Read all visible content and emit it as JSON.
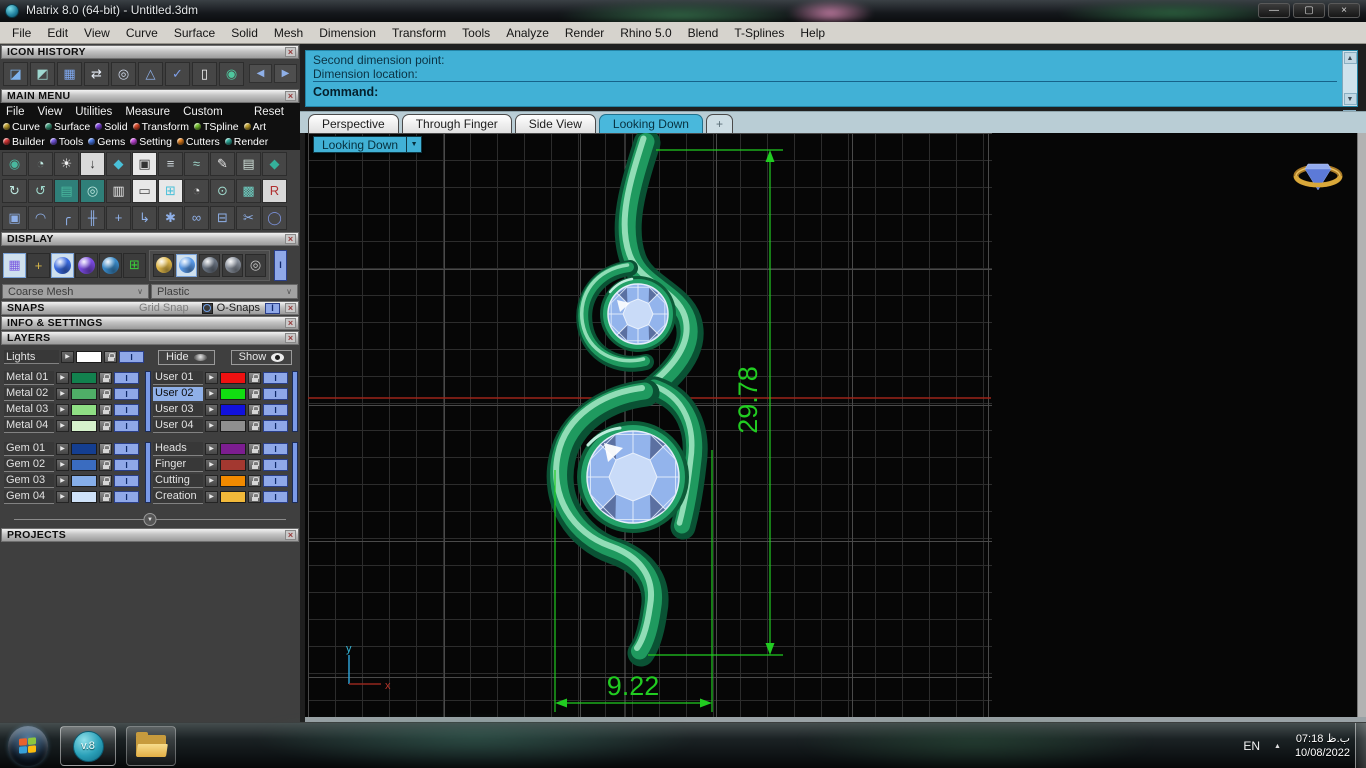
{
  "window": {
    "title": "Matrix 8.0 (64-bit) - Untitled.3dm",
    "minimize": "—",
    "restore": "▢",
    "close": "×"
  },
  "ui": {
    "x": "×",
    "back": "◀",
    "fwd": "▶",
    "up": "▲",
    "down": "▼",
    "caret": "∨"
  },
  "menu_bar": [
    "File",
    "Edit",
    "View",
    "Curve",
    "Surface",
    "Solid",
    "Mesh",
    "Dimension",
    "Transform",
    "Tools",
    "Analyze",
    "Render",
    "Rhino 5.0",
    "Blend",
    "T-Splines",
    "Help"
  ],
  "command": {
    "history": [
      "Second dimension point:",
      "Dimension location:"
    ],
    "prompt": "Command:"
  },
  "icon_history": {
    "title": "ICON HISTORY",
    "icons": [
      {
        "n": "open-file-icon",
        "g": "◪",
        "c": "#7fb3ef"
      },
      {
        "n": "render-history-icon",
        "g": "◩",
        "c": "#9fd8d0"
      },
      {
        "n": "grid-view-icon",
        "g": "▦",
        "c": "#7fa8ef"
      },
      {
        "n": "scale-2d-icon",
        "g": "⇄",
        "c": "#e8eef8"
      },
      {
        "n": "gem-round-icon",
        "g": "◎",
        "c": "#cfd8ea"
      },
      {
        "n": "gauge-icon",
        "g": "△",
        "c": "#8fb0e8"
      },
      {
        "n": "check-icon",
        "g": "✓",
        "c": "#7f9fe8"
      },
      {
        "n": "new-document-icon",
        "g": "▯",
        "c": "#f8f8f8"
      },
      {
        "n": "vray-icon",
        "g": "◉",
        "c": "#4fc89e"
      }
    ]
  },
  "main_menu": {
    "title": "MAIN MENU",
    "top_items": [
      "File",
      "View",
      "Utilities",
      "Measure",
      "Custom"
    ],
    "reset_label": "Reset",
    "cats1": [
      {
        "n": "main-menu-curve",
        "label": "Curve",
        "c": "#c8a832"
      },
      {
        "n": "main-menu-surface",
        "label": "Surface",
        "c": "#3a9a7a"
      },
      {
        "n": "main-menu-solid",
        "label": "Solid",
        "c": "#7d3fe0"
      },
      {
        "n": "main-menu-transform",
        "label": "Transform",
        "c": "#e04a2a"
      },
      {
        "n": "main-menu-tspline",
        "label": "TSpline",
        "c": "#7ac832"
      },
      {
        "n": "main-menu-art",
        "label": "Art",
        "c": "#c8a832"
      }
    ],
    "cats2": [
      {
        "n": "main-menu-builder",
        "label": "Builder",
        "c": "#e03a3a"
      },
      {
        "n": "main-menu-tools",
        "label": "Tools",
        "c": "#7a5ae8"
      },
      {
        "n": "main-menu-gems",
        "label": "Gems",
        "c": "#4a7ae8"
      },
      {
        "n": "main-menu-setting",
        "label": "Setting",
        "c": "#c84ae0"
      },
      {
        "n": "main-menu-cutters",
        "label": "Cutters",
        "c": "#e8821e"
      },
      {
        "n": "main-menu-render",
        "label": "Render",
        "c": "#2fae9e"
      }
    ]
  },
  "toolbars": {
    "row1": [
      {
        "n": "vray-sphere-icon",
        "g": "◉",
        "c": "#49b89e"
      },
      {
        "n": "ring-wizard-icon",
        "g": "◔",
        "c": "#bfe8e0"
      },
      {
        "n": "lighting-icon",
        "g": "☀",
        "c": "#f2f2f2"
      },
      {
        "n": "extrude-surface-icon",
        "g": "↓",
        "c": "#333333",
        "b": "#d9d9d9"
      },
      {
        "n": "gem-studio-icon",
        "g": "◆",
        "c": "#49c0d8"
      },
      {
        "n": "chip-icon",
        "g": "▣",
        "c": "#333333",
        "b": "#e8e8e8"
      },
      {
        "n": "rail-sweep-icon",
        "g": "≡",
        "c": "#cfd8dd"
      },
      {
        "n": "hand-sculpt-icon",
        "g": "≈",
        "c": "#9fd8cc"
      },
      {
        "n": "paint-icon",
        "g": "✎",
        "c": "#e8e8e8"
      },
      {
        "n": "image-icon",
        "g": "▤",
        "c": "#cfe0d8"
      },
      {
        "n": "bezel-gem-icon",
        "g": "◆",
        "c": "#35b09a"
      }
    ],
    "row2": [
      {
        "n": "rotate-ring-icon",
        "g": "↻",
        "c": "#bfe8e0"
      },
      {
        "n": "flow-ring-icon",
        "g": "↺",
        "c": "#9fd8cc"
      },
      {
        "n": "history-panel-icon",
        "g": "▤",
        "c": "#49b89e",
        "b": "#2f7f79"
      },
      {
        "n": "halo-ring-icon",
        "g": "◎",
        "c": "#bfe8e0",
        "b": "#2f7f79"
      },
      {
        "n": "stack-copies-icon",
        "g": "▥",
        "c": "#e8e8e8"
      },
      {
        "n": "logo-stamp-icon",
        "g": "▭",
        "c": "#444444",
        "b": "#e8e8e8"
      },
      {
        "n": "quad-gem-icon",
        "g": "⊞",
        "c": "#49c0d8",
        "b": "#e8e8e8"
      },
      {
        "n": "clock-ring-icon",
        "g": "◔",
        "c": "#e8e8e8"
      },
      {
        "n": "magnet-ring-icon",
        "g": "⊙",
        "c": "#9fd8cc"
      },
      {
        "n": "mesh-stone-icon",
        "g": "▩",
        "c": "#6fd0c4"
      },
      {
        "n": "save-icon",
        "g": "R",
        "c": "#b03030",
        "b": "#d9d9d9"
      }
    ],
    "row3": [
      {
        "n": "cubes-icon",
        "g": "▣",
        "c": "#8fb0e8"
      },
      {
        "n": "arc-icon",
        "g": "◠",
        "c": "#8fb0e8"
      },
      {
        "n": "corner-curve-icon",
        "g": "╭",
        "c": "#8fb0e8"
      },
      {
        "n": "mirror-icon",
        "g": "╫",
        "c": "#8fb0e8"
      },
      {
        "n": "move-icon",
        "g": "+",
        "c": "#8fb0e8"
      },
      {
        "n": "orient-icon",
        "g": "↳",
        "c": "#8fb0e8"
      },
      {
        "n": "explode-icon",
        "g": "✱",
        "c": "#8fb0e8"
      },
      {
        "n": "link-icon",
        "g": "∞",
        "c": "#8fb0e8"
      },
      {
        "n": "split-icon",
        "g": "⊟",
        "c": "#8fb0e8"
      },
      {
        "n": "trim-icon",
        "g": "✂",
        "c": "#8fb0e8"
      },
      {
        "n": "torus-icon",
        "g": "◯",
        "c": "#7a90d8"
      }
    ]
  },
  "display": {
    "title": "DISPLAY",
    "modes": [
      {
        "n": "wireframe-mode-icon",
        "g": "▦",
        "c": "#7a5ae0",
        "sel": true
      },
      {
        "n": "axes-mode-icon",
        "g": "+",
        "c": "#d8b84a"
      },
      {
        "n": "shaded-mode-icon",
        "ball": "#3a6ae0",
        "sel": true
      },
      {
        "n": "rendered-mode-icon",
        "ball": "#7a4ae0"
      },
      {
        "n": "artistic-mode-icon",
        "ball": "#3a8ac8"
      },
      {
        "n": "green-grid-mode-icon",
        "g": "⊞",
        "c": "#3ad03a"
      }
    ],
    "materials": [
      {
        "n": "gold-material-icon",
        "ball": "#e0b84a"
      },
      {
        "n": "plastic-material-icon",
        "ball": "#5a9ae8",
        "sel": true
      },
      {
        "n": "metal-material-icon",
        "ball": "#6a7482"
      },
      {
        "n": "matte-material-icon",
        "ball": "#878e9a"
      },
      {
        "n": "wire-material-icon",
        "g": "◎",
        "c": "#c8c8c8"
      }
    ],
    "mesh_dropdown": "Coarse Mesh",
    "material_dropdown": "Plastic"
  },
  "snaps": {
    "title": "SNAPS",
    "grid_snap_label": "Grid Snap",
    "osnaps_label": "O-Snaps"
  },
  "info_settings": {
    "title": "INFO & SETTINGS"
  },
  "layers": {
    "title": "LAYERS",
    "lights_label": "Lights",
    "hide_label": "Hide",
    "show_label": "Show",
    "metal": [
      {
        "n": "layer-metal-01",
        "name": "Metal 01",
        "color": "#12814e"
      },
      {
        "n": "layer-metal-02",
        "name": "Metal 02",
        "color": "#4fae67"
      },
      {
        "n": "layer-metal-03",
        "name": "Metal 03",
        "color": "#8fdf84"
      },
      {
        "n": "layer-metal-04",
        "name": "Metal 04",
        "color": "#d6f2cc"
      }
    ],
    "user": [
      {
        "n": "layer-user-01",
        "name": "User 01",
        "color": "#ee1111"
      },
      {
        "n": "layer-user-02",
        "name": "User 02",
        "color": "#11dd11",
        "selected": true
      },
      {
        "n": "layer-user-03",
        "name": "User 03",
        "color": "#1111dd"
      },
      {
        "n": "layer-user-04",
        "name": "User 04",
        "color": "#8f8f8f"
      }
    ],
    "gem": [
      {
        "n": "layer-gem-01",
        "name": "Gem 01",
        "color": "#143e90"
      },
      {
        "n": "layer-gem-02",
        "name": "Gem 02",
        "color": "#3a6cc0"
      },
      {
        "n": "layer-gem-03",
        "name": "Gem 03",
        "color": "#86aee8"
      },
      {
        "n": "layer-gem-04",
        "name": "Gem 04",
        "color": "#cfe2f8"
      }
    ],
    "parts": [
      {
        "n": "layer-heads",
        "name": "Heads",
        "color": "#7c1d90"
      },
      {
        "n": "layer-finger",
        "name": "Finger",
        "color": "#a33830"
      },
      {
        "n": "layer-cutting",
        "name": "Cutting",
        "color": "#f28a00"
      },
      {
        "n": "layer-creation",
        "name": "Creation",
        "color": "#f2b93a"
      }
    ]
  },
  "projects": {
    "title": "PROJECTS"
  },
  "viewport": {
    "tabs": [
      {
        "n": "tab-perspective",
        "label": "Perspective"
      },
      {
        "n": "tab-through-finger",
        "label": "Through Finger"
      },
      {
        "n": "tab-side-view",
        "label": "Side View"
      },
      {
        "n": "tab-looking-down",
        "label": "Looking Down",
        "active": true
      },
      {
        "n": "tab-new",
        "label": "+",
        "new": true
      }
    ],
    "view_label": "Looking Down",
    "dim_vertical": "29.78",
    "dim_horizontal": "9.22",
    "axis_x": "x",
    "axis_y": "y"
  },
  "taskbar": {
    "language": "EN",
    "tray_expand": "▲",
    "time": "07:18 ب.ظ",
    "date": "10/08/2022",
    "v8_label": "v.8"
  },
  "colors": {
    "accent_cyan": "#41b1d6",
    "dimension_green": "#21cc21",
    "axis_red": "#9b2418",
    "metal_green": "#23a268",
    "gem_blue": "#93b4ec"
  }
}
